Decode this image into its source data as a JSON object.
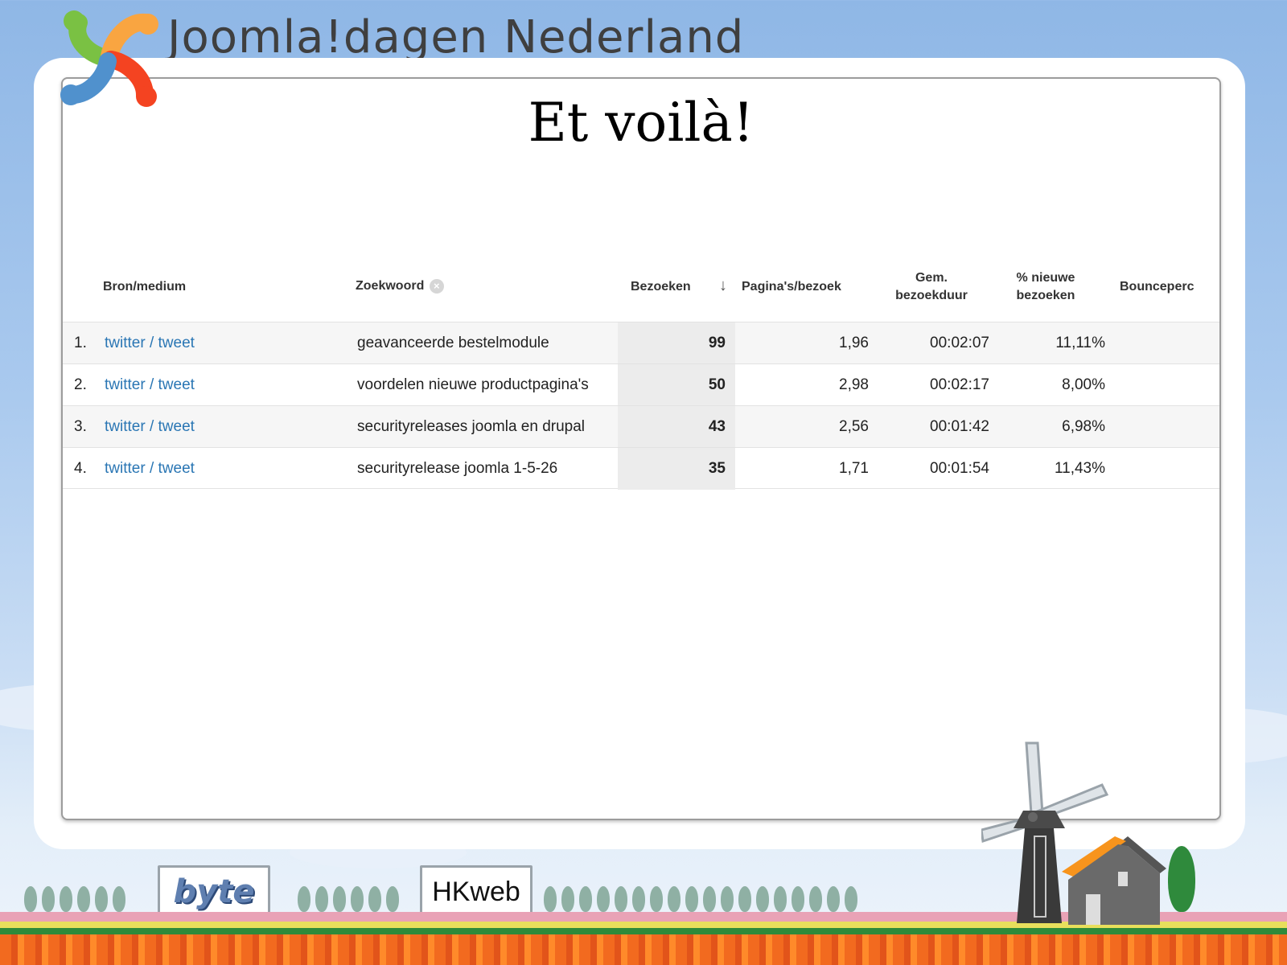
{
  "header": {
    "site_title": "Joomla!dagen Nederland"
  },
  "slide": {
    "title": "Et voilà!"
  },
  "table": {
    "columns": {
      "source": "Bron/medium",
      "keyword": "Zoekwoord",
      "visits": "Bezoeken",
      "pages_per_visit": "Pagina's/bezoek",
      "avg_duration_line1": "Gem.",
      "avg_duration_line2": "bezoekduur",
      "new_visits_line1": "% nieuwe",
      "new_visits_line2": "bezoeken",
      "bounce": "Bounceperc"
    },
    "rows": [
      {
        "num": "1.",
        "source": "twitter / tweet",
        "keyword": "geavanceerde bestelmodule",
        "visits": "99",
        "pages_per_visit": "1,96",
        "avg_duration": "00:02:07",
        "new_visits": "11,11%"
      },
      {
        "num": "2.",
        "source": "twitter / tweet",
        "keyword": "voordelen nieuwe productpagina's",
        "visits": "50",
        "pages_per_visit": "2,98",
        "avg_duration": "00:02:17",
        "new_visits": "8,00%"
      },
      {
        "num": "3.",
        "source": "twitter / tweet",
        "keyword": "securityreleases joomla en drupal",
        "visits": "43",
        "pages_per_visit": "2,56",
        "avg_duration": "00:01:42",
        "new_visits": "6,98%"
      },
      {
        "num": "4.",
        "source": "twitter / tweet",
        "keyword": "securityrelease joomla 1-5-26",
        "visits": "35",
        "pages_per_visit": "1,71",
        "avg_duration": "00:01:54",
        "new_visits": "11,43%"
      }
    ]
  },
  "footer": {
    "sponsor1": "byte",
    "sponsor2": "HKweb"
  },
  "colors": {
    "link": "#2a76b4",
    "joomla_green": "#7ac143",
    "joomla_orange": "#f9a541",
    "joomla_red": "#f44321",
    "joomla_blue": "#5091cd"
  },
  "icons": {
    "logo": "joomla-logo",
    "sort": "sort-down-arrow-icon",
    "remove": "remove-circle-icon",
    "windmill": "windmill",
    "house": "house"
  }
}
